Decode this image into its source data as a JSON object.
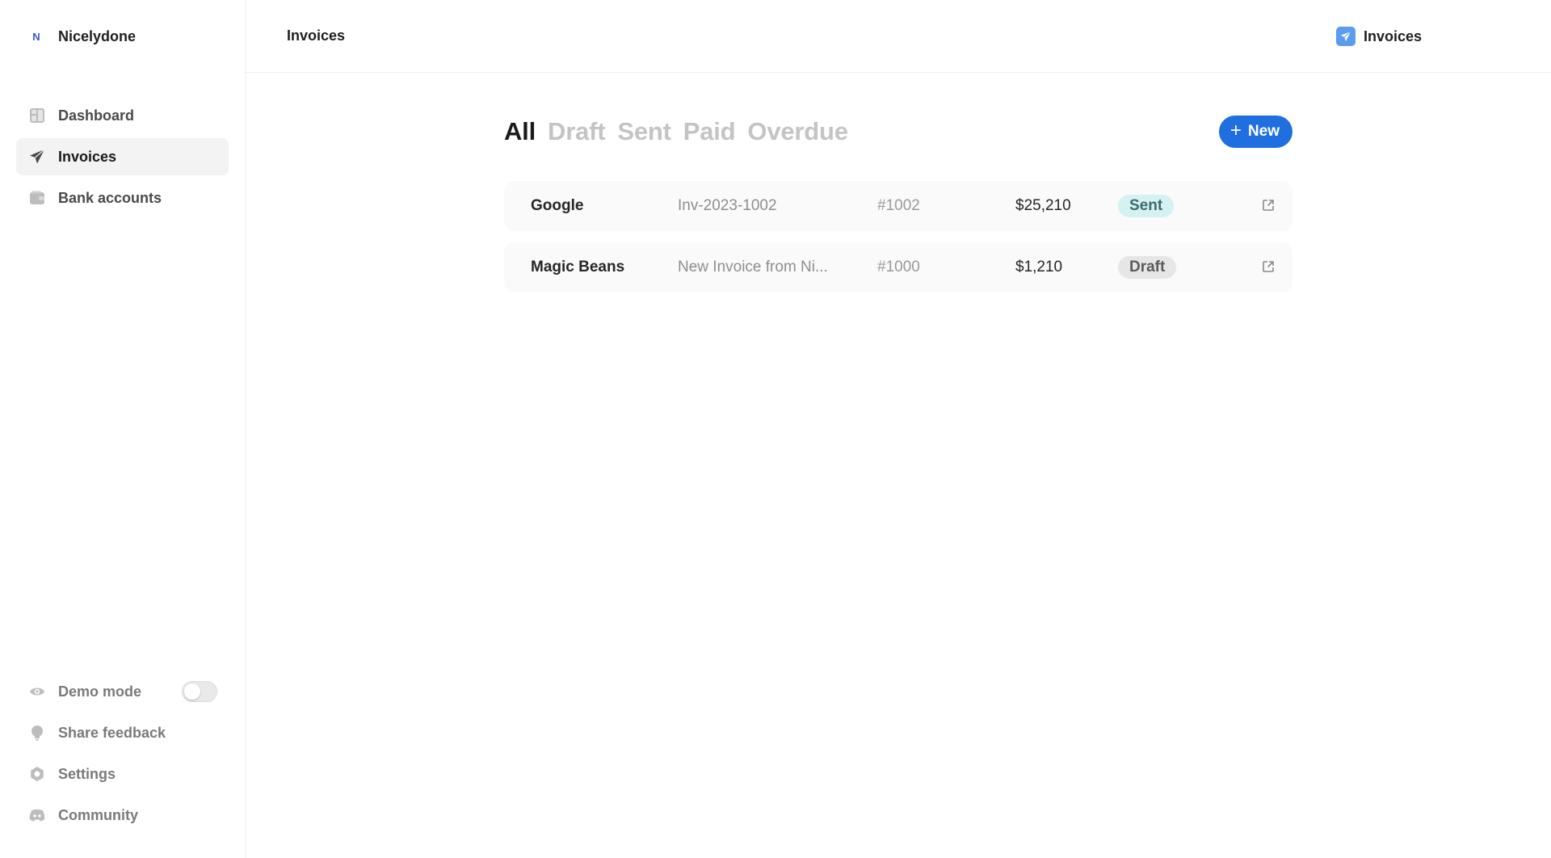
{
  "sidebar": {
    "brand": {
      "logo": "N",
      "name": "Nicelydone"
    },
    "nav": [
      {
        "label": "Dashboard",
        "icon": "dashboard-icon",
        "active": false
      },
      {
        "label": "Invoices",
        "icon": "send-icon",
        "active": true
      },
      {
        "label": "Bank accounts",
        "icon": "wallet-icon",
        "active": false
      }
    ],
    "bottom": {
      "demo_mode": {
        "label": "Demo mode",
        "icon": "eye-icon",
        "enabled": false
      },
      "share_feedback": {
        "label": "Share feedback",
        "icon": "lightbulb-icon"
      },
      "settings": {
        "label": "Settings",
        "icon": "gear-icon"
      },
      "community": {
        "label": "Community",
        "icon": "discord-icon"
      }
    }
  },
  "topbar": {
    "title": "Invoices",
    "right_label": "Invoices",
    "right_icon": "send-icon"
  },
  "tabs": [
    {
      "label": "All",
      "active": true
    },
    {
      "label": "Draft",
      "active": false
    },
    {
      "label": "Sent",
      "active": false
    },
    {
      "label": "Paid",
      "active": false
    },
    {
      "label": "Overdue",
      "active": false
    }
  ],
  "new_button": {
    "label": "New"
  },
  "colors": {
    "accent": "#1f6fe0",
    "sent_badge_bg": "#d6f1f2",
    "draft_badge_bg": "#e6e6e6"
  },
  "invoices": [
    {
      "client": "Google",
      "title": "Inv-2023-1002",
      "number": "#1002",
      "amount": "$25,210",
      "status": "Sent"
    },
    {
      "client": "Magic Beans",
      "title": "New Invoice from Ni...",
      "number": "#1000",
      "amount": "$1,210",
      "status": "Draft"
    }
  ]
}
